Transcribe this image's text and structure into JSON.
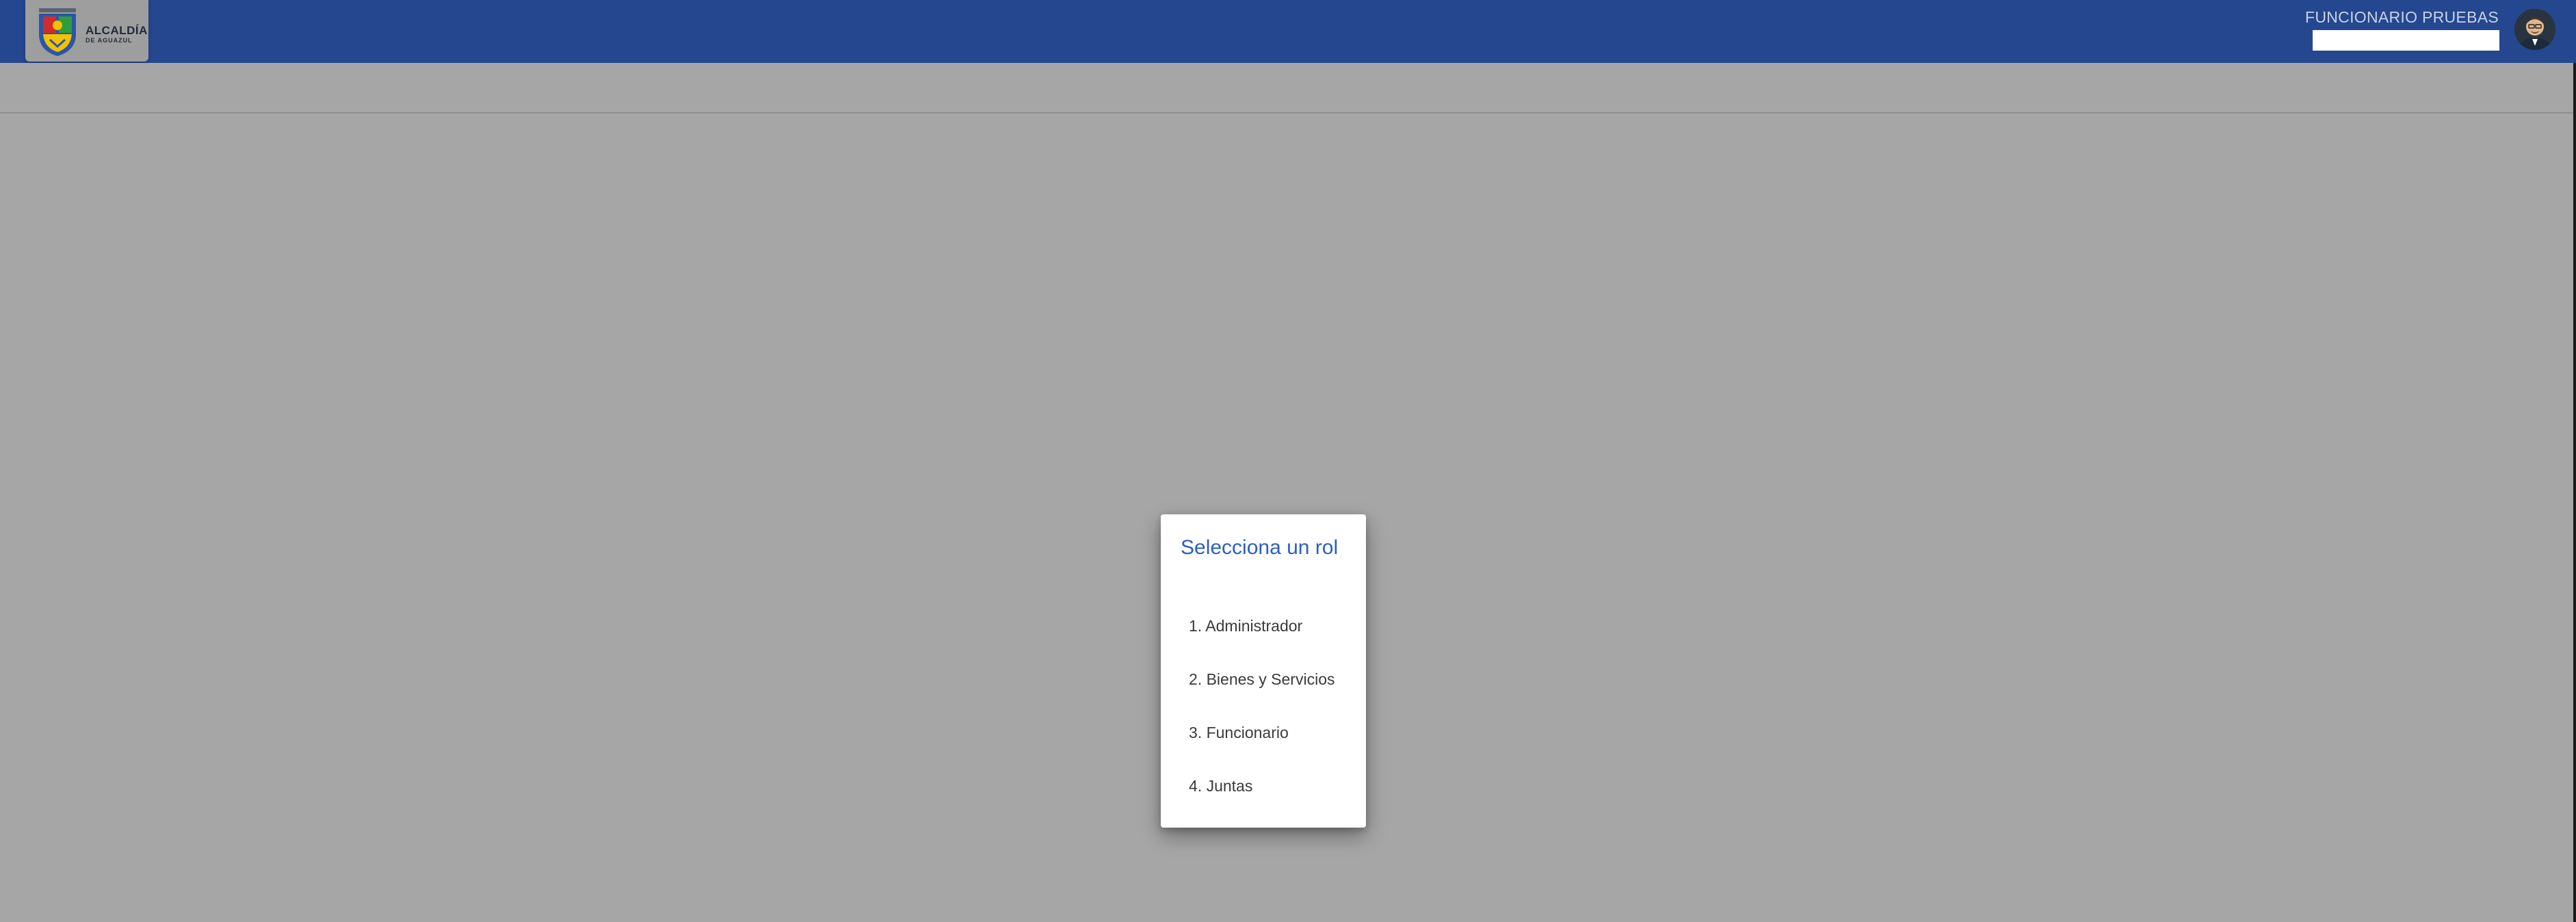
{
  "header": {
    "logo": {
      "main_text": "ALCALDÍA",
      "sub_text": "DE AGUAZUL",
      "icon": "municipal-shield-icon",
      "colors": {
        "blue": "#2b56a8",
        "red": "#d22b2b",
        "yellow": "#f2c200",
        "green": "#2f9e3a"
      }
    },
    "user": {
      "name": "FUNCIONARIO PRUEBAS",
      "field_value": "",
      "avatar_icon": "user-avatar-icon"
    }
  },
  "dialog": {
    "title": "Selecciona un rol",
    "roles": [
      {
        "label": "1. Administrador"
      },
      {
        "label": "2. Bienes y Servicios"
      },
      {
        "label": "3. Funcionario"
      },
      {
        "label": "4. Juntas"
      }
    ]
  },
  "colors": {
    "topbar": "#24478f",
    "backdrop": "#a6a6a6",
    "title_accent": "#2a5fc4",
    "dialog_bg": "#ffffff"
  }
}
